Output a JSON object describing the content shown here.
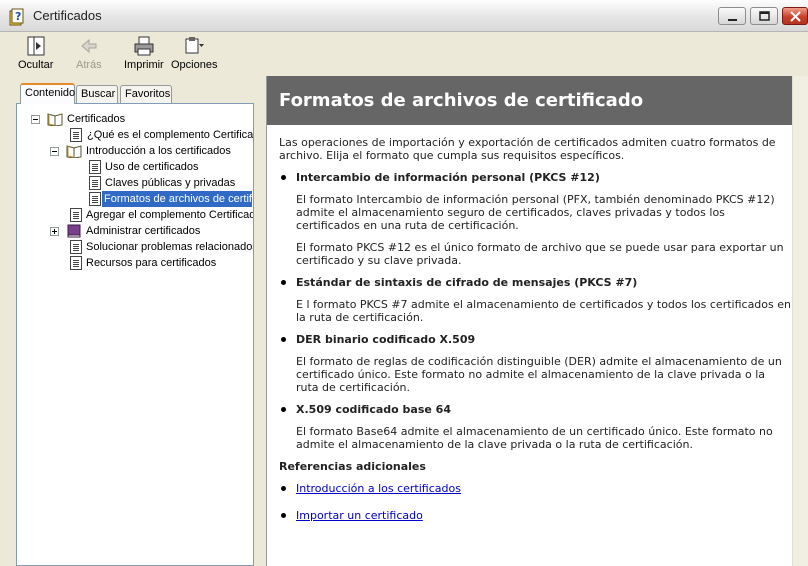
{
  "window": {
    "title": "Certificados"
  },
  "toolbar": {
    "hide_label": "Ocultar",
    "back_label": "Atrás",
    "print_label": "Imprimir",
    "options_label": "Opciones"
  },
  "tabs": [
    "Contenido",
    "Buscar",
    "Favoritos"
  ],
  "tree": [
    {
      "label": "Certificados",
      "type": "book",
      "expanded": true
    },
    {
      "label": "¿Qué es el complemento Certificados?",
      "type": "page"
    },
    {
      "label": "Introducción a los certificados",
      "type": "book",
      "expanded": true
    },
    {
      "label": "Uso de certificados",
      "type": "page"
    },
    {
      "label": "Claves públicas y privadas",
      "type": "page"
    },
    {
      "label": "Formatos de archivos de certificado",
      "type": "page",
      "selected": true
    },
    {
      "label": "Agregar el complemento Certificados",
      "type": "page"
    },
    {
      "label": "Administrar certificados",
      "type": "book",
      "expanded": false
    },
    {
      "label": "Solucionar problemas relacionados",
      "type": "page"
    },
    {
      "label": "Recursos para certificados",
      "type": "page"
    }
  ],
  "article": {
    "heading": "Formatos de archivos de certificado",
    "intro": "Las operaciones de importación y exportación de certificados admiten cuatro formatos de archivo. Elija el formato que cumpla sus requisitos específicos.",
    "sections": [
      {
        "title": "Intercambio de información personal (PKCS #12)",
        "paragraphs": [
          "El formato Intercambio de información personal (PFX, también denominado PKCS #12) admite el almacenamiento seguro de certificados, claves privadas y todos los certificados en una ruta de certificación.",
          "El formato PKCS #12 es el único formato de archivo que se puede usar para exportar un certificado y su clave privada."
        ]
      },
      {
        "title": "Estándar de sintaxis de cifrado de mensajes (PKCS #7)",
        "paragraphs": [
          "E l formato PKCS #7 admite el almacenamiento de certificados y todos los certificados en la ruta de certificación."
        ]
      },
      {
        "title": "DER binario codificado X.509",
        "paragraphs": [
          "El formato de reglas de codificación distinguible (DER) admite el almacenamiento de un certificado único. Este formato no admite el almacenamiento de la clave privada o la ruta de certificación."
        ]
      },
      {
        "title": "X.509 codificado base 64",
        "paragraphs": [
          "El formato Base64 admite el almacenamiento de un certificado único. Este formato no admite el almacenamiento de la clave privada o la ruta de certificación."
        ]
      }
    ],
    "refs_heading": "Referencias adicionales",
    "refs": [
      "Introducción a los certificados",
      "Importar un certificado"
    ]
  },
  "colors": {
    "banner": "#666666",
    "selection": "#316ac5",
    "link": "#0000cc"
  }
}
